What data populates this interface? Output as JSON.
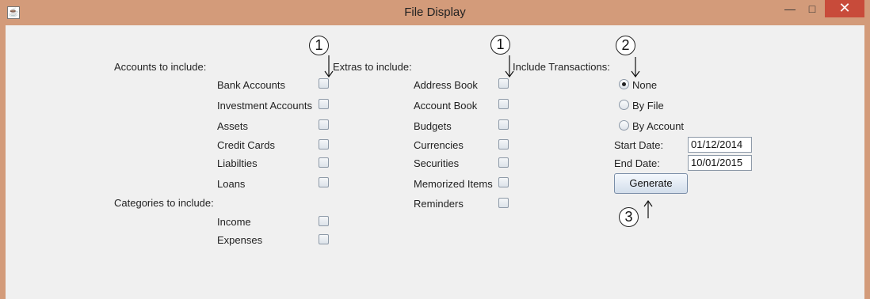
{
  "window": {
    "title": "File Display",
    "minimize_glyph": "—",
    "maximize_glyph": "□",
    "close_glyph": "✕"
  },
  "accounts": {
    "heading": "Accounts to include:",
    "items": [
      {
        "label": "Bank Accounts",
        "checked": false
      },
      {
        "label": "Investment Accounts",
        "checked": false
      },
      {
        "label": "Assets",
        "checked": false
      },
      {
        "label": "Credit Cards",
        "checked": false
      },
      {
        "label": "Liabilties",
        "checked": false
      },
      {
        "label": "Loans",
        "checked": false
      }
    ]
  },
  "categories": {
    "heading": "Categories to include:",
    "items": [
      {
        "label": "Income",
        "checked": false
      },
      {
        "label": "Expenses",
        "checked": false
      }
    ]
  },
  "extras": {
    "heading": "Extras to include:",
    "items": [
      {
        "label": "Address Book",
        "checked": false
      },
      {
        "label": "Account Book",
        "checked": false
      },
      {
        "label": "Budgets",
        "checked": false
      },
      {
        "label": "Currencies",
        "checked": false
      },
      {
        "label": "Securities",
        "checked": false
      },
      {
        "label": "Memorized Items",
        "checked": false
      },
      {
        "label": "Reminders",
        "checked": false
      }
    ]
  },
  "transactions": {
    "heading": "Include Transactions:",
    "options": [
      {
        "label": "None",
        "selected": true
      },
      {
        "label": "By File",
        "selected": false
      },
      {
        "label": "By Account",
        "selected": false
      }
    ],
    "start_label": "Start Date:",
    "start_value": "01/12/2014",
    "end_label": "End Date:",
    "end_value": "10/01/2015",
    "generate_label": "Generate"
  },
  "annotations": [
    "1",
    "1",
    "2",
    "3"
  ]
}
